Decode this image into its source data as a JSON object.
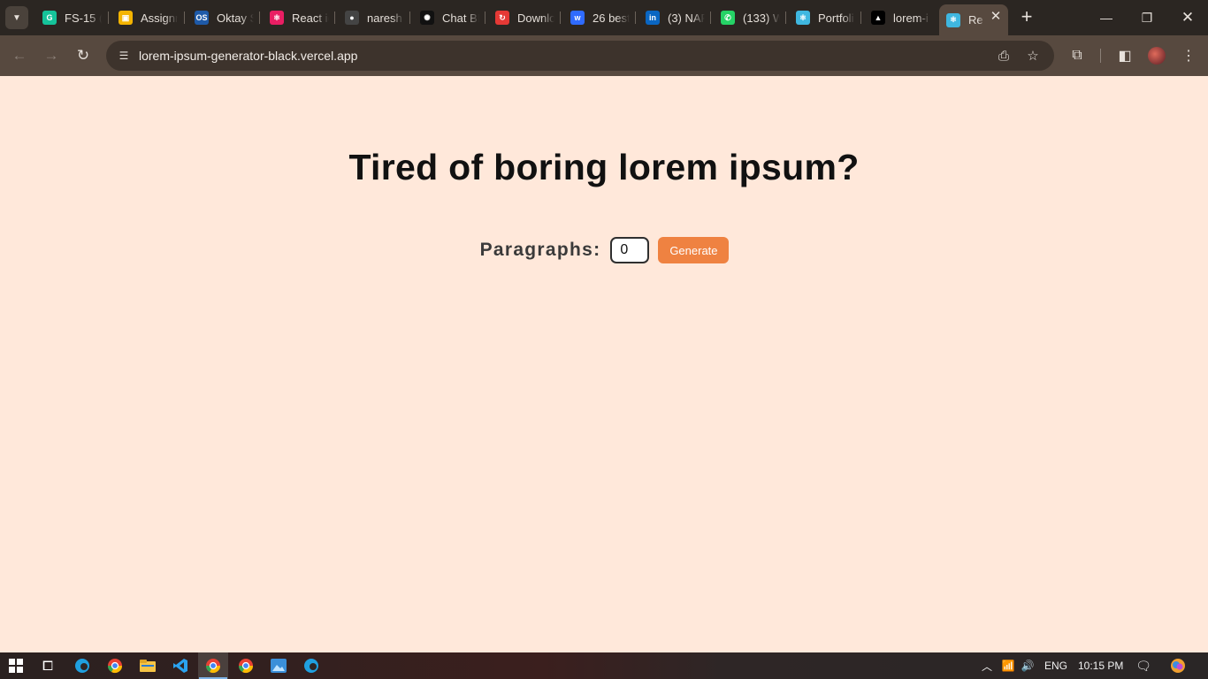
{
  "browser": {
    "tabs": [
      {
        "title": "FS-15 (",
        "icon": "grammarly-icon",
        "color": "#15c39a",
        "glyph": "G"
      },
      {
        "title": "Assignm",
        "icon": "slides-icon",
        "color": "#f4b400",
        "glyph": "▣"
      },
      {
        "title": "Oktay S",
        "icon": "os-icon",
        "color": "#1e5aa8",
        "glyph": "OS"
      },
      {
        "title": "React ic",
        "icon": "react-icons-icon",
        "color": "#e91e63",
        "glyph": "⚛"
      },
      {
        "title": "naresh",
        "icon": "github-icon",
        "color": "#444444",
        "glyph": "●"
      },
      {
        "title": "Chat BI",
        "icon": "openai-icon",
        "color": "#111111",
        "glyph": "✺"
      },
      {
        "title": "Downlo",
        "icon": "download-icon",
        "color": "#e53935",
        "glyph": "↻"
      },
      {
        "title": "26 best",
        "icon": "webflow-icon",
        "color": "#2f6bff",
        "glyph": "w"
      },
      {
        "title": "(3) NAF",
        "icon": "linkedin-icon",
        "color": "#0a66c2",
        "glyph": "in"
      },
      {
        "title": "(133) W",
        "icon": "whatsapp-icon",
        "color": "#25d366",
        "glyph": "✆"
      },
      {
        "title": "Portfoli",
        "icon": "react-icon",
        "color": "#3fb7e0",
        "glyph": "⚛"
      },
      {
        "title": "lorem-i",
        "icon": "vercel-icon",
        "color": "#000000",
        "glyph": "▲"
      },
      {
        "title": "Re",
        "icon": "react-icon",
        "color": "#3fb7e0",
        "glyph": "⚛",
        "active": true
      }
    ],
    "url": "lorem-ipsum-generator-black.vercel.app"
  },
  "page": {
    "heading": "Tired of boring lorem ipsum?",
    "paragraphs_label": "Paragraphs:",
    "paragraphs_value": "0",
    "generate_label": "Generate"
  },
  "taskbar": {
    "language": "ENG",
    "time": "10:15 PM"
  },
  "colors": {
    "page_background": "#ffe8da",
    "accent": "#ef8241",
    "browser_frame": "#57493f"
  }
}
